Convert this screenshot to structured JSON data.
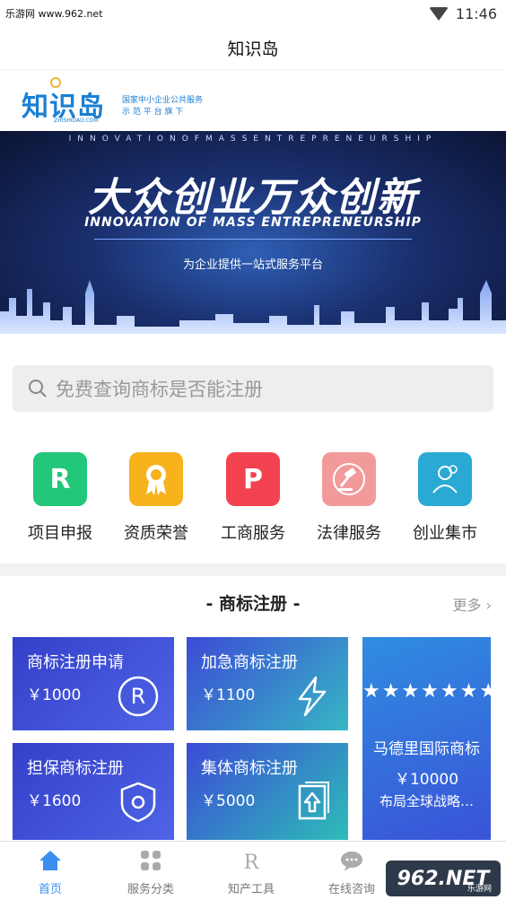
{
  "status_bar": {
    "watermark_text": "乐游网 www.962.net",
    "time": "11:46"
  },
  "header": {
    "title": "知识岛"
  },
  "brand": {
    "logo_text": "知识岛",
    "logo_sub": "ZHISHIDAO.COM",
    "slogan_line1": "国家中小企业公共服务",
    "slogan_line2": "示 范 平 台 旗 下"
  },
  "banner": {
    "top_line": "INNOVATIONOFMASSENTREPRENEURSHIP",
    "headline": "大众创业万众创新",
    "english": "INNOVATION OF MASS ENTREPRENEURSHIP",
    "tagline": "为企业提供一站式服务平台"
  },
  "search": {
    "placeholder": "免费查询商标是否能注册"
  },
  "categories": [
    {
      "label": "项目申报",
      "icon": "R",
      "color": "#22c77a"
    },
    {
      "label": "资质荣誉",
      "icon": "award-icon",
      "color": "#f7b21c"
    },
    {
      "label": "工商服务",
      "icon": "P",
      "color": "#f2424f"
    },
    {
      "label": "法律服务",
      "icon": "gavel-icon",
      "color": "#f29a9a"
    },
    {
      "label": "创业集市",
      "icon": "person-icon",
      "color": "#2aa9d4"
    }
  ],
  "section": {
    "title": "- 商标注册 -",
    "more": "更多 ›"
  },
  "products": [
    {
      "name": "商标注册申请",
      "price": "￥1000",
      "icon": "registered-icon"
    },
    {
      "name": "加急商标注册",
      "price": "￥1100",
      "icon": "lightning-icon"
    },
    {
      "name": "担保商标注册",
      "price": "￥1600",
      "icon": "shield-icon"
    },
    {
      "name": "集体商标注册",
      "price": "￥5000",
      "icon": "upload-doc-icon"
    }
  ],
  "featured": {
    "stars": "★★★★★★★",
    "name": "马德里国际商标",
    "price": "￥10000",
    "desc": "布局全球战略…"
  },
  "tabs": [
    {
      "label": "首页",
      "icon": "home-icon",
      "active": true
    },
    {
      "label": "服务分类",
      "icon": "grid-icon",
      "active": false
    },
    {
      "label": "知产工具",
      "icon": "r-tool-icon",
      "active": false
    },
    {
      "label": "在线咨询",
      "icon": "chat-icon",
      "active": false
    }
  ],
  "corner_watermark": {
    "main": "962.NET",
    "sub": "乐游网"
  },
  "colors": {
    "accent": "#3b8ff0",
    "card_blue": "#3a4fd8",
    "card_teal": "#2dbdb8"
  }
}
